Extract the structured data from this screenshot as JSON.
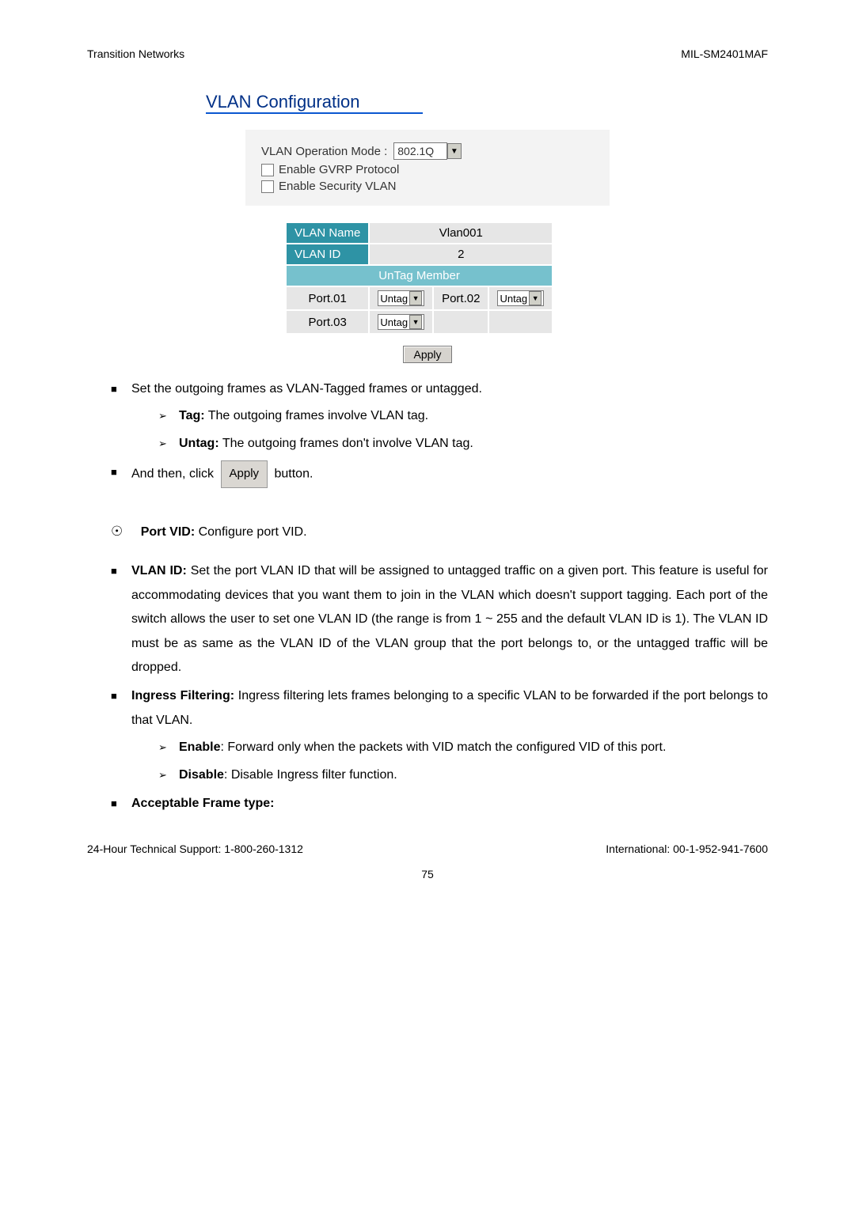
{
  "header": {
    "left": "Transition Networks",
    "right": "MIL-SM2401MAF"
  },
  "title": "VLAN Configuration",
  "config": {
    "modeLabel": "VLAN Operation Mode : ",
    "modeValue": "802.1Q",
    "gvrpLabel": " Enable GVRP Protocol",
    "secVlanLabel": " Enable Security VLAN"
  },
  "table": {
    "nameLabel": "VLAN Name",
    "nameValue": "Vlan001",
    "idLabel": "VLAN ID",
    "idValue": "2",
    "untagHeader": "UnTag Member",
    "p01": "Port.01",
    "p02": "Port.02",
    "p03": "Port.03",
    "untagSel": "Untag"
  },
  "applyBtn": "Apply",
  "bul1": "Set the outgoing frames as VLAN-Tagged frames or untagged.",
  "sub1a_b": "Tag:",
  "sub1a_t": " The outgoing frames involve VLAN tag.",
  "sub1b_b": "Untag:",
  "sub1b_t": " The outgoing frames don't involve VLAN tag.",
  "bul2a": "And then, click ",
  "bul2b": " button.",
  "applyInline": "Apply",
  "portVid_b": "Port VID:",
  "portVid_t": " Configure port VID.",
  "vlanid_b": "VLAN ID:",
  "vlanid_t": " Set the port VLAN ID that will be assigned to untagged traffic on a given port. This feature is useful for accommodating devices that you want them to join in the VLAN which doesn't support tagging. Each port of the switch allows the user to set one VLAN ID (the range is from 1 ~ 255 and the default VLAN ID is 1). The VLAN ID must be as same as the VLAN ID of the VLAN group that the port belongs to, or the untagged traffic will be dropped.",
  "ingress_b": "Ingress Filtering:",
  "ingress_t": " Ingress filtering lets frames belonging to a specific VLAN to be forwarded if the port belongs to that VLAN.",
  "enable_b": "Enable",
  "enable_t": ": Forward only when the packets with VID match the configured VID of this port.",
  "disable_b": "Disable",
  "disable_t": ": Disable Ingress filter function.",
  "aft_b": "Acceptable Frame type:",
  "footer": {
    "left": "24-Hour Technical Support: 1-800-260-1312",
    "right": "International: 00-1-952-941-7600"
  },
  "pageNumber": "75"
}
